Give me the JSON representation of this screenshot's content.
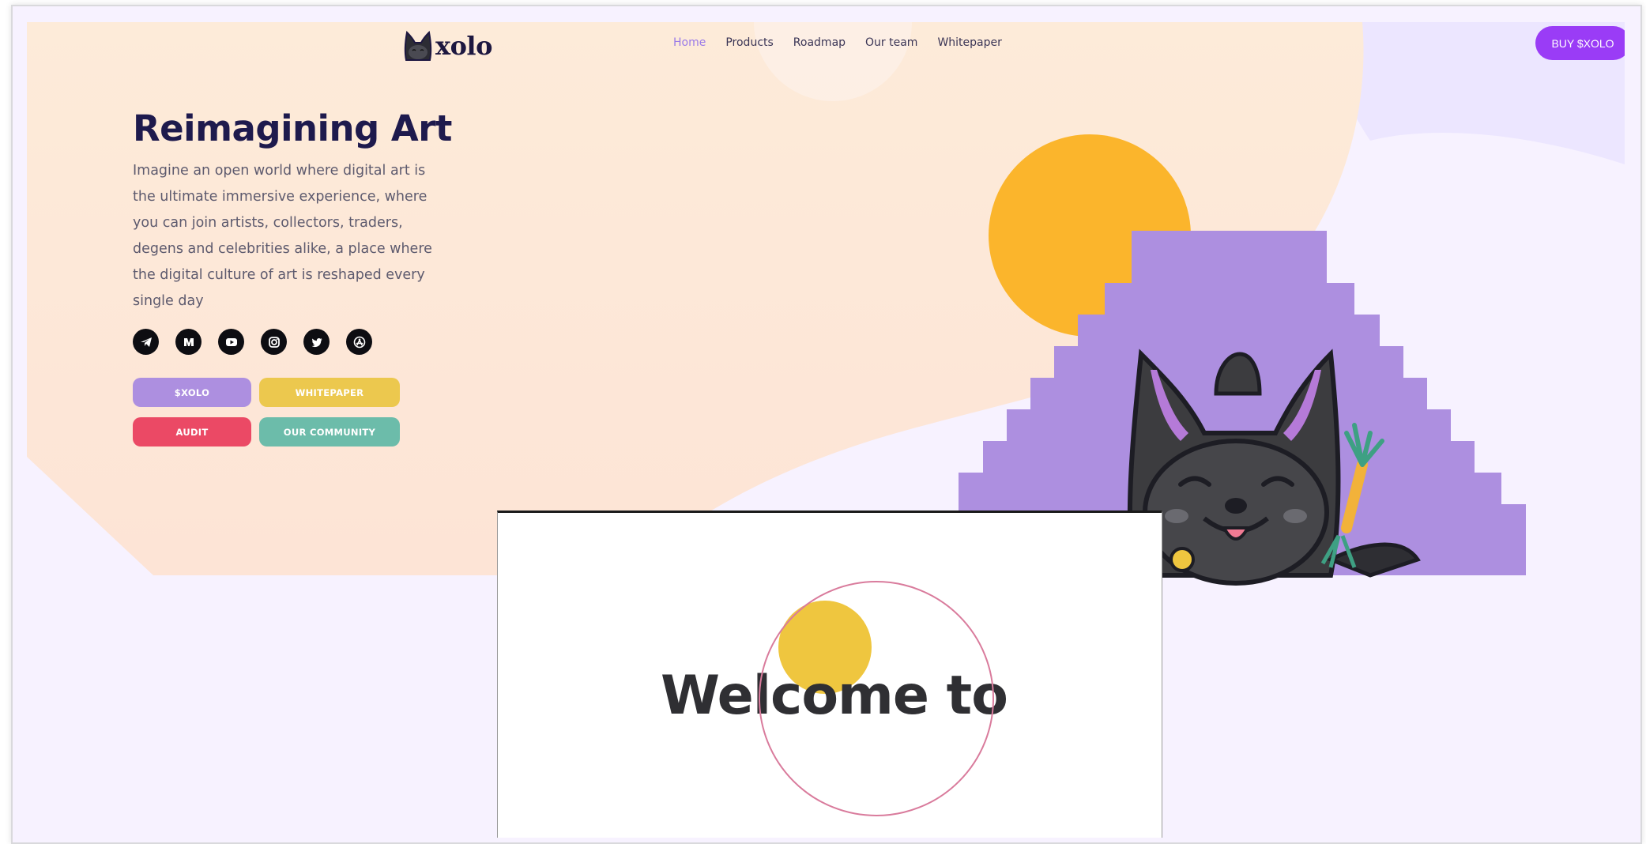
{
  "brand": {
    "name": "xolo",
    "logo_icon": "xolo-dog-head-icon"
  },
  "nav": {
    "items": [
      {
        "label": "Home",
        "active": true
      },
      {
        "label": "Products",
        "active": false
      },
      {
        "label": "Roadmap",
        "active": false
      },
      {
        "label": "Our team",
        "active": false
      },
      {
        "label": "Whitepaper",
        "active": false
      }
    ],
    "cta_label": "BUY $XOLO"
  },
  "hero": {
    "title": "Reimagining Art",
    "description": "Imagine an open world where digital art is the ultimate immersive experience, where you can join artists, collectors, traders, degens and celebrities alike, a place where the digital culture of art is reshaped every single day",
    "socials": [
      "telegram-icon",
      "medium-icon",
      "youtube-icon",
      "instagram-icon",
      "twitter-icon",
      "app-store-icon"
    ],
    "buttons": {
      "xolo": "$XOLO",
      "whitepaper": "WHITEPAPER",
      "audit": "AUDIT",
      "community": "OUR COMMUNITY"
    }
  },
  "welcome": {
    "text": "Welcome to"
  },
  "colors": {
    "accent": "#9a3cf6",
    "nav_active": "#9b7be8",
    "title": "#1e1a4d",
    "peach_bg": "#fde8d8",
    "lavender_bg": "#f7f2ff",
    "sun": "#fbb52c",
    "pyramid": "#ad8fe0",
    "btn_xolo": "#ad8fe0",
    "btn_whitepaper": "#ecc84e",
    "btn_audit": "#eb4965",
    "btn_community": "#6cbcaa"
  }
}
